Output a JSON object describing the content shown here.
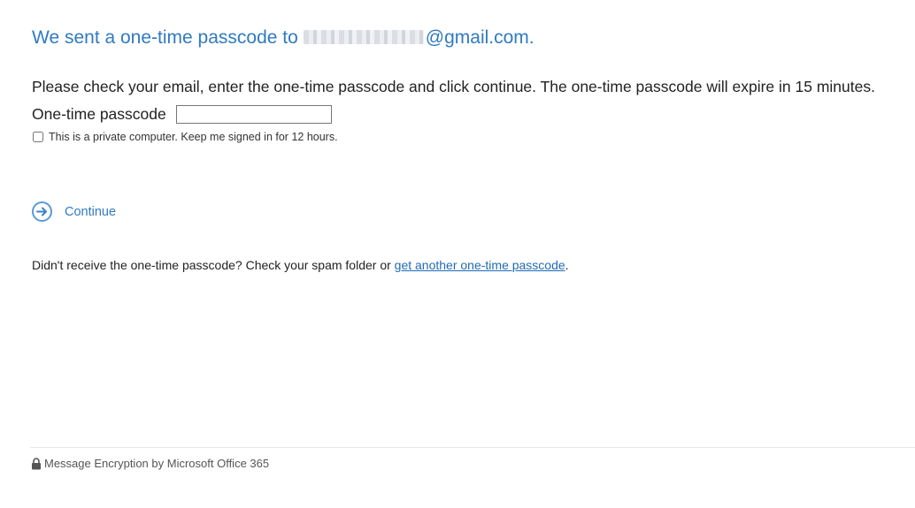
{
  "heading": {
    "prefix": "We sent a one-time passcode to",
    "email_domain": "@gmail.com."
  },
  "instructions": "Please check your email, enter the one-time passcode and click continue. The one-time passcode will expire in 15 minutes.",
  "passcode": {
    "label": "One-time passcode",
    "value": "",
    "placeholder": ""
  },
  "remember": {
    "label": "This is a private computer. Keep me signed in for 12 hours.",
    "checked": false
  },
  "continue": {
    "label": "Continue",
    "icon": "arrow-right-circle-icon"
  },
  "resend": {
    "text": "Didn't receive the one-time passcode? Check your spam folder or ",
    "link_label": "get another one-time passcode",
    "suffix": "."
  },
  "footer": {
    "icon": "lock-icon",
    "text": "Message Encryption by Microsoft Office 365"
  },
  "colors": {
    "accent": "#2f7ac1",
    "link": "#1f6bb5"
  }
}
